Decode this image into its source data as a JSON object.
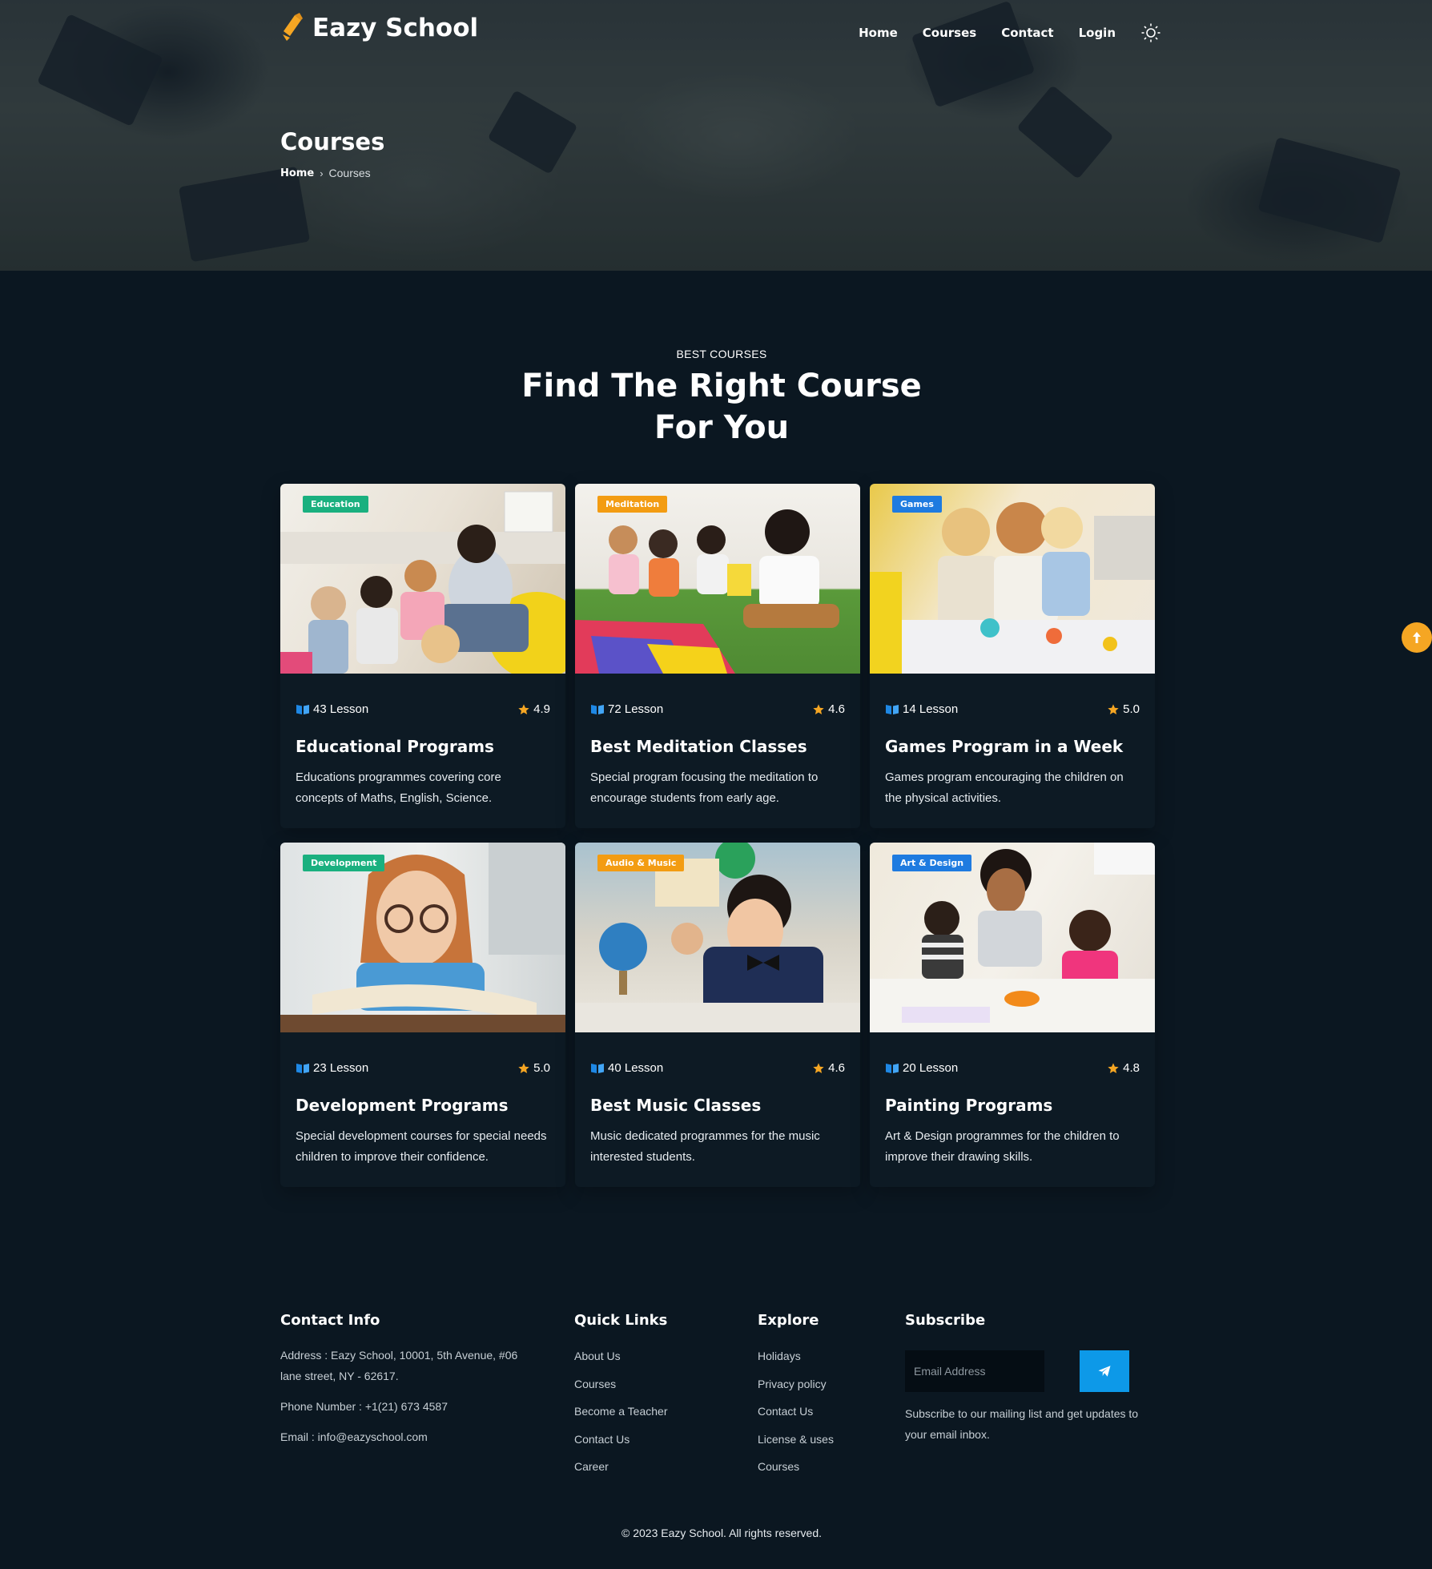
{
  "brand": {
    "name": "Eazy School",
    "accent": "#f5a623"
  },
  "nav": {
    "items": [
      {
        "label": "Home"
      },
      {
        "label": "Courses"
      },
      {
        "label": "Contact"
      },
      {
        "label": "Login"
      }
    ],
    "theme_icon": "sun-icon"
  },
  "page_header": {
    "title": "Courses",
    "breadcrumb": {
      "home": "Home",
      "separator": "›",
      "current": "Courses"
    }
  },
  "section": {
    "eyebrow": "BEST COURSES",
    "title_line1": "Find The Right Course",
    "title_line2": "For You"
  },
  "courses": [
    {
      "badge": "Education",
      "badge_color": "#1ab07f",
      "lessons": "43 Lesson",
      "rating": "4.9",
      "title": "Educational Programs",
      "desc_line1": "Educations programmes covering core",
      "desc_line2": "concepts of Maths, English, Science."
    },
    {
      "badge": "Meditation",
      "badge_color": "#f39c12",
      "lessons": "72 Lesson",
      "rating": "4.6",
      "title": "Best Meditation Classes",
      "desc_line1": "Special program focusing the meditation to",
      "desc_line2": "encourage students from early age."
    },
    {
      "badge": "Games",
      "badge_color": "#1e7be0",
      "lessons": "14 Lesson",
      "rating": "5.0",
      "title": "Games Program in a Week",
      "desc_line1": "Games program encouraging the children on",
      "desc_line2": "the physical activities."
    },
    {
      "badge": "Development",
      "badge_color": "#1ab07f",
      "lessons": "23 Lesson",
      "rating": "5.0",
      "title": "Development Programs",
      "desc_line1": "Special development courses for special needs",
      "desc_line2": "children to improve their confidence."
    },
    {
      "badge": "Audio & Music",
      "badge_color": "#f39c12",
      "lessons": "40 Lesson",
      "rating": "4.6",
      "title": "Best Music Classes",
      "desc_line1": "Music dedicated programmes for the music",
      "desc_line2": "interested students."
    },
    {
      "badge": "Art & Design",
      "badge_color": "#1e7be0",
      "lessons": "20 Lesson",
      "rating": "4.8",
      "title": "Painting Programs",
      "desc_line1": "Art & Design programmes for the children to",
      "desc_line2": "improve their drawing skills."
    }
  ],
  "footer": {
    "contact": {
      "heading": "Contact Info",
      "address_line1": "Address : Eazy School, 10001, 5th Avenue, #06",
      "address_line2": "lane street, NY - 62617.",
      "phone": "Phone Number : +1(21) 673 4587",
      "email": "Email : info@eazyschool.com"
    },
    "quick_links": {
      "heading": "Quick Links",
      "items": [
        "About Us",
        "Courses",
        "Become a Teacher",
        "Contact Us",
        "Career"
      ]
    },
    "explore": {
      "heading": "Explore",
      "items": [
        "Holidays",
        "Privacy policy",
        "Contact Us",
        "License & uses",
        "Courses"
      ]
    },
    "subscribe": {
      "heading": "Subscribe",
      "placeholder": "Email Address",
      "text_line1": "Subscribe to our mailing list and get updates to",
      "text_line2": "your email inbox."
    },
    "copyright": "© 2023 Eazy School. All rights reserved."
  },
  "colors": {
    "background": "#0b1721",
    "card": "#0d1a24",
    "subscribe_button": "#0d99e8"
  }
}
